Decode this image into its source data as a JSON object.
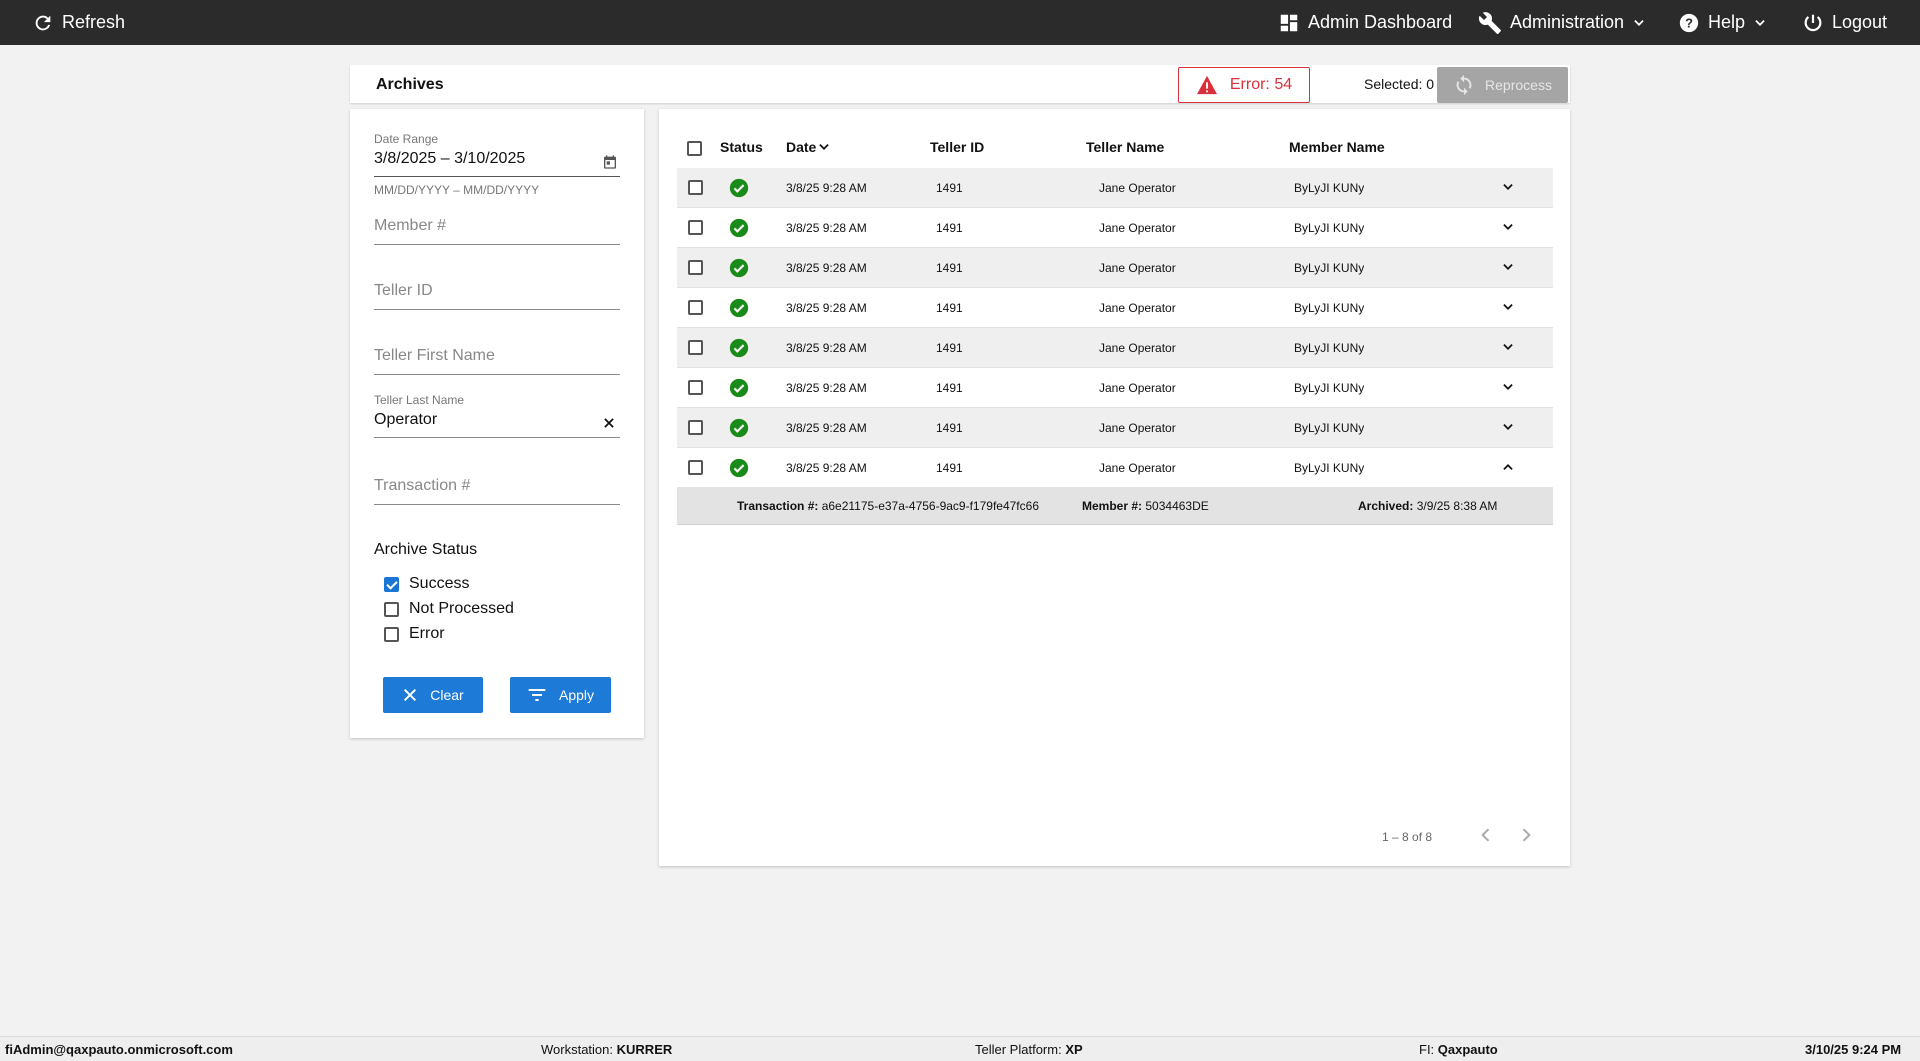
{
  "topbar": {
    "refresh": "Refresh",
    "admin_dashboard": "Admin Dashboard",
    "administration": "Administration",
    "help": "Help",
    "logout": "Logout"
  },
  "header": {
    "title": "Archives",
    "error_badge": "Error: 54",
    "selected": "Selected: 0",
    "reprocess": "Reprocess"
  },
  "filters": {
    "date_range_label": "Date Range",
    "date_range_value": "3/8/2025 – 3/10/2025",
    "date_range_hint": "MM/DD/YYYY – MM/DD/YYYY",
    "member_placeholder": "Member #",
    "teller_id_placeholder": "Teller ID",
    "teller_first_placeholder": "Teller First Name",
    "teller_last_label": "Teller Last Name",
    "teller_last_value": "Operator",
    "transaction_placeholder": "Transaction #",
    "archive_status_label": "Archive Status",
    "statuses": [
      {
        "label": "Success",
        "checked": true
      },
      {
        "label": "Not Processed",
        "checked": false
      },
      {
        "label": "Error",
        "checked": false
      }
    ],
    "clear": "Clear",
    "apply": "Apply"
  },
  "table": {
    "columns": [
      "Status",
      "Date",
      "Teller ID",
      "Teller Name",
      "Member Name"
    ],
    "rows": [
      {
        "date": "3/8/25 9:28 AM",
        "teller_id": "1491",
        "teller_name": "Jane Operator",
        "member_name": "ByLyJI KUNy"
      },
      {
        "date": "3/8/25 9:28 AM",
        "teller_id": "1491",
        "teller_name": "Jane Operator",
        "member_name": "ByLyJI KUNy"
      },
      {
        "date": "3/8/25 9:28 AM",
        "teller_id": "1491",
        "teller_name": "Jane Operator",
        "member_name": "ByLyJI KUNy"
      },
      {
        "date": "3/8/25 9:28 AM",
        "teller_id": "1491",
        "teller_name": "Jane Operator",
        "member_name": "ByLyJI KUNy"
      },
      {
        "date": "3/8/25 9:28 AM",
        "teller_id": "1491",
        "teller_name": "Jane Operator",
        "member_name": "ByLyJI KUNy"
      },
      {
        "date": "3/8/25 9:28 AM",
        "teller_id": "1491",
        "teller_name": "Jane Operator",
        "member_name": "ByLyJI KUNy"
      },
      {
        "date": "3/8/25 9:28 AM",
        "teller_id": "1491",
        "teller_name": "Jane Operator",
        "member_name": "ByLyJI KUNy"
      },
      {
        "date": "3/8/25 9:28 AM",
        "teller_id": "1491",
        "teller_name": "Jane Operator",
        "member_name": "ByLyJI KUNy"
      }
    ],
    "detail": {
      "transaction_label": "Transaction #:",
      "transaction_value": "a6e21175-e37a-4756-9ac9-f179fe47fc66",
      "member_label": "Member #:",
      "member_value": "5034463DE",
      "archived_label": "Archived:",
      "archived_value": "3/9/25 8:38 AM"
    },
    "pager": "1 – 8 of 8"
  },
  "footer": {
    "user": "fiAdmin@qaxpauto.onmicrosoft.com",
    "workstation_label": "Workstation:",
    "workstation_value": "KURRER",
    "platform_label": "Teller Platform:",
    "platform_value": "XP",
    "fi_label": "FI:",
    "fi_value": "Qaxpauto",
    "datetime": "3/10/25 9:24 PM"
  },
  "colors": {
    "success": "#1a8a1a",
    "error": "#d9313b",
    "primary": "#1d7ad6"
  }
}
